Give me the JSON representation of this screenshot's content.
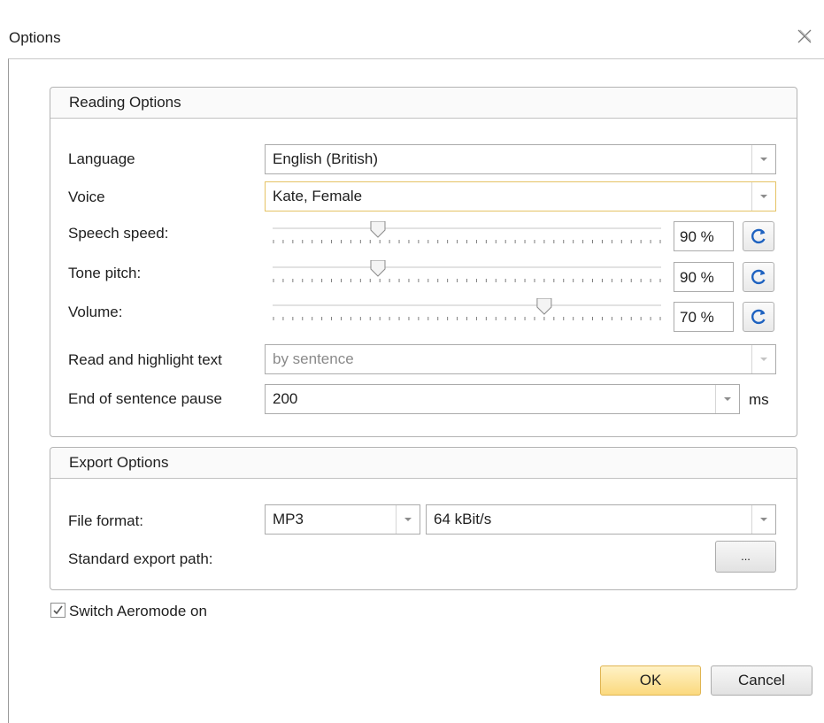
{
  "window": {
    "title": "Options"
  },
  "reading": {
    "heading": "Reading Options",
    "language": {
      "label": "Language",
      "value": "English (British)"
    },
    "voice": {
      "label": "Voice",
      "value": "Kate, Female"
    },
    "speed": {
      "label": "Speech speed:",
      "value": "90 %",
      "level": 0.27
    },
    "pitch": {
      "label": "Tone pitch:",
      "value": "90 %",
      "level": 0.27
    },
    "volume": {
      "label": "Volume:",
      "value": "70 %",
      "level": 0.7
    },
    "highlight": {
      "label": "Read and highlight text",
      "value": "by sentence"
    },
    "pause": {
      "label": "End of sentence pause",
      "value": "200",
      "unit": "ms"
    }
  },
  "export": {
    "heading": "Export Options",
    "format": {
      "label": "File format:",
      "value": "MP3",
      "bitrate": "64 kBit/s"
    },
    "path": {
      "label": "Standard export path:",
      "browse": "..."
    }
  },
  "aero": {
    "label": "Switch Aeromode on",
    "checked": true
  },
  "buttons": {
    "ok": "OK",
    "cancel": "Cancel"
  },
  "colors": {
    "reset_icon": "#1e62c0",
    "ok_fill": "#fbd97e",
    "focus_border": "#e5c365"
  }
}
